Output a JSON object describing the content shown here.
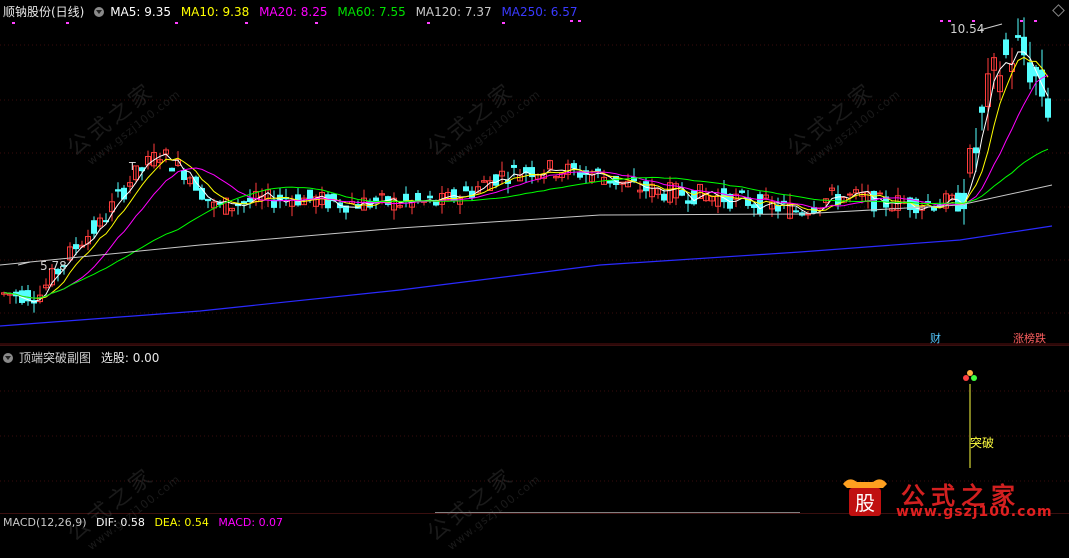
{
  "main": {
    "legend": {
      "stock": "顺钠股份(日线)",
      "ma5": "MA5: 9.35",
      "ma10": "MA10: 9.38",
      "ma20": "MA20: 8.25",
      "ma60": "MA60: 7.55",
      "ma120": "MA120: 7.37",
      "ma250": "MA250: 6.57"
    },
    "high_label": "10.54",
    "low_label": "5.78",
    "cai_tag": "财",
    "zhangbang_tag": "涨榜跌",
    "t_marker": "T"
  },
  "sub": {
    "title": "顶端突破副图",
    "value": "选股: 0.00",
    "signal_label": "突破"
  },
  "macd": {
    "label": "MACD(12,26,9)",
    "dif": "DIF: 0.58",
    "dea": "DEA: 0.54",
    "macd": "MACD: 0.07"
  },
  "watermark": {
    "title": "公式之家",
    "url": "www.gszj100.com",
    "seal": "股",
    "ghost": "公式之家",
    "ghost_url": "www.gszj100.com"
  },
  "colors": {
    "up": "#ff3c3c",
    "down": "#54ffff",
    "ma5": "#ffffff",
    "ma10": "#ffff00",
    "ma20": "#ff00ff",
    "ma60": "#00ff00",
    "ma120": "#c8c8c8",
    "ma250": "#2a2aff"
  }
}
